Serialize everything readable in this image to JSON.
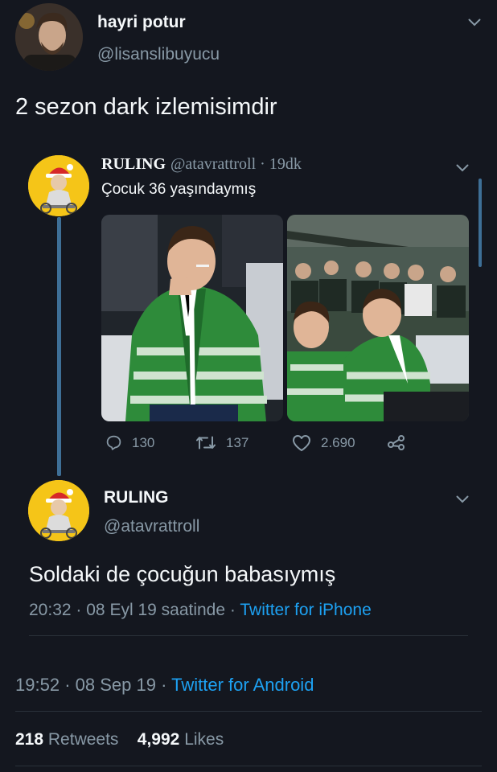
{
  "tweet": {
    "author_name": "hayri potur",
    "author_handle": "@lisanslibuyucu",
    "text": "2 sezon dark izlemisimdir",
    "meta": {
      "time": "19:52",
      "date": "08 Sep 19",
      "source": "Twitter for Android"
    },
    "stats": {
      "retweets_count": "218",
      "retweets_label": "Retweets",
      "likes_count": "4,992",
      "likes_label": "Likes"
    }
  },
  "quoted": {
    "author_name": "RULING",
    "author_handle": "@atavrattroll",
    "age": "19dk",
    "text": "Çocuk 36 yaşındaymış",
    "actions": {
      "replies": "130",
      "retweets": "137",
      "likes": "2.690"
    }
  },
  "reply": {
    "author_name": "RULING",
    "author_handle": "@atavrattroll",
    "text": "Soldaki de çocuğun babasıymış",
    "meta": {
      "time": "20:32",
      "date": "08 Eyl 19 saatinde",
      "source": "Twitter for iPhone"
    }
  },
  "icons": [
    "chevron-down-icon",
    "reply-icon",
    "retweet-icon",
    "like-icon",
    "share-icon"
  ],
  "colors": {
    "background": "#14171f",
    "text": "#f5f8fa",
    "muted": "#8899a6",
    "link": "#1da1f2",
    "thread_line": "#3e6f96"
  }
}
